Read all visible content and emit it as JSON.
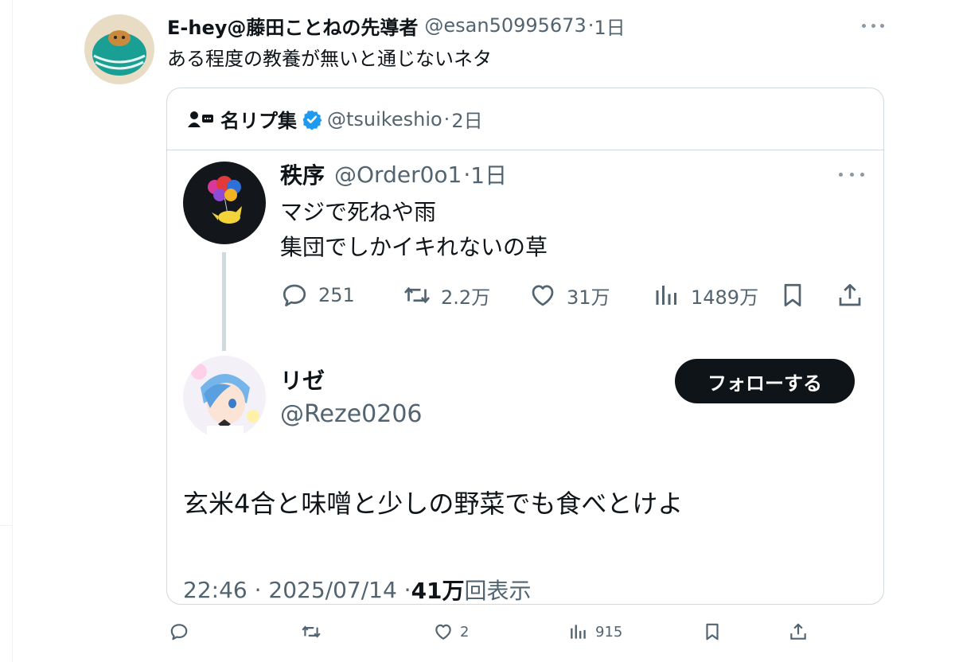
{
  "tweet": {
    "author_name": "E-hey@藤田ことねの先導者",
    "author_handle": "@esan50995673",
    "time": "1日",
    "text": "ある程度の教養が無いと通じないネタ",
    "actions": {
      "reply_count": "",
      "retweet_count": "",
      "like_count": "2",
      "view_count": "915"
    }
  },
  "quote": {
    "author_name": "名リプ集",
    "author_handle": "@tsuikeshio",
    "time": "2日",
    "reply": {
      "author_name": "秩序",
      "author_handle": "@Order0o1",
      "time": "1日",
      "lines": [
        "マジで死ねや雨",
        "集団でしかイキれないの草"
      ],
      "actions": {
        "reply_count": "251",
        "retweet_count": "2.2万",
        "like_count": "31万",
        "view_count": "1489万"
      }
    },
    "main": {
      "author_name": "リゼ",
      "author_handle": "@Reze0206",
      "follow_label": "フォローする",
      "text": "玄米4合と味噌と少しの野菜でも食べとけよ",
      "timestamp": "22:46 · 2025/07/14 · ",
      "views_count": "41万",
      "views_suffix": "回表示"
    }
  },
  "colors": {
    "text": "#0f1419",
    "secondary": "#536471",
    "border": "#cfd9de",
    "verified": "#1d9bf0",
    "follow_button": "#0f1419"
  }
}
